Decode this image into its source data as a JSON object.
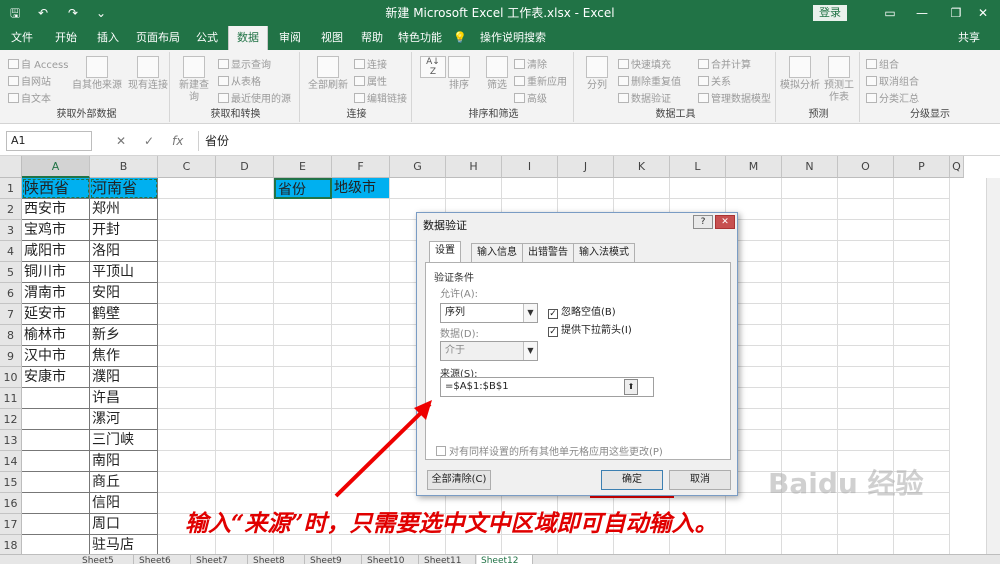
{
  "window": {
    "title": "新建 Microsoft Excel 工作表.xlsx  -  Excel",
    "login_label": "登录",
    "minimize": "—",
    "restore": "❐",
    "close": "✕"
  },
  "quick_access": {
    "save": "🖫",
    "undo": "↶",
    "redo": "↷",
    "more": "⌄"
  },
  "tabs": [
    {
      "label": "文件"
    },
    {
      "label": "开始"
    },
    {
      "label": "插入"
    },
    {
      "label": "页面布局"
    },
    {
      "label": "公式"
    },
    {
      "label": "数据"
    },
    {
      "label": "审阅"
    },
    {
      "label": "视图"
    },
    {
      "label": "帮助"
    },
    {
      "label": "特色功能"
    },
    {
      "label": "操作说明搜索"
    },
    {
      "label": "共享"
    }
  ],
  "ribbon": {
    "external": {
      "access": "自 Access",
      "web": "自网站",
      "text": "自文本",
      "other": "自其他来源",
      "existing": "现有连接",
      "label": "获取外部数据"
    },
    "transform": {
      "new_query": "新建查询",
      "show_query": "显示查询",
      "from_table": "从表格",
      "recent": "最近使用的源",
      "label": "获取和转换"
    },
    "connections": {
      "refresh_all": "全部刷新",
      "connections": "连接",
      "properties": "属性",
      "edit_links": "编辑链接",
      "label": "连接"
    },
    "sortfilter": {
      "sort": "排序",
      "filter": "筛选",
      "clear": "清除",
      "reapply": "重新应用",
      "advanced": "高级",
      "label": "排序和筛选"
    },
    "datatools": {
      "split": "分列",
      "flash_fill": "快速填充",
      "remove_dup": "删除重复值",
      "validation": "数据验证",
      "consolidate": "合并计算",
      "relationships": "关系",
      "model": "管理数据模型",
      "label": "数据工具"
    },
    "forecast": {
      "whatif": "模拟分析",
      "sheet": "预测工作表",
      "label": "预测"
    },
    "outline": {
      "group": "组合",
      "ungroup": "取消组合",
      "subtotal": "分类汇总",
      "label": "分级显示"
    }
  },
  "formula_bar": {
    "name_box": "A1",
    "content": "省份",
    "cancel": "✕",
    "enter": "✓",
    "fx": "fx"
  },
  "columns": [
    "A",
    "B",
    "C",
    "D",
    "E",
    "F",
    "G",
    "H",
    "I",
    "J",
    "K",
    "L",
    "M",
    "N",
    "O",
    "P",
    "Q"
  ],
  "rows": [
    "1",
    "2",
    "3",
    "4",
    "5",
    "6",
    "7",
    "8",
    "9",
    "10",
    "11",
    "12",
    "13",
    "14",
    "15",
    "16",
    "17",
    "18"
  ],
  "cells": {
    "colA": [
      "陕西省",
      "西安市",
      "宝鸡市",
      "咸阳市",
      "铜川市",
      "渭南市",
      "延安市",
      "榆林市",
      "汉中市",
      "安康市"
    ],
    "colB": [
      "河南省",
      "郑州",
      "开封",
      "洛阳",
      "平顶山",
      "安阳",
      "鹤壁",
      "新乡",
      "焦作",
      "濮阳",
      "许昌",
      "漯河",
      "三门峡",
      "南阳",
      "商丘",
      "信阳",
      "周口",
      "驻马店"
    ],
    "E1": "省份",
    "F1": "地级市"
  },
  "sheets": [
    "Sheet5",
    "Sheet6",
    "Sheet7",
    "Sheet8",
    "Sheet9",
    "Sheet10",
    "Sheet11",
    "Sheet12"
  ],
  "dialog": {
    "title": "数据验证",
    "help": "?",
    "close": "✕",
    "tabs": [
      "设置",
      "输入信息",
      "出错警告",
      "输入法模式"
    ],
    "criteria_label": "验证条件",
    "allow_label": "允许(A):",
    "allow_value": "序列",
    "data_label": "数据(D):",
    "data_value": "介于",
    "ignore_blank": "忽略空值(B)",
    "dropdown": "提供下拉箭头(I)",
    "source_label": "来源(S):",
    "source_value": "=$A$1:$B$1",
    "apply_all": "对有同样设置的所有其他单元格应用这些更改(P)",
    "clear_all": "全部清除(C)",
    "ok": "确定",
    "cancel": "取消",
    "check_mark": "✓"
  },
  "annotation": "输入“来源”时，只需要选中文中区域即可自动输入。",
  "watermark": "Baidu 经验",
  "accent_color": "#217346",
  "highlight_color": "#00b0f0",
  "mark_color": "#ee0000"
}
